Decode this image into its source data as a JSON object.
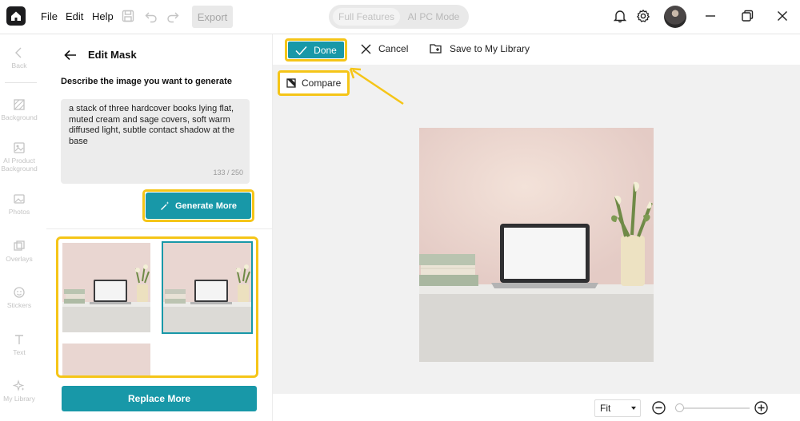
{
  "menu": {
    "file": "File",
    "edit": "Edit",
    "help": "Help",
    "export": "Export"
  },
  "mode_switch": {
    "full": "Full Features",
    "ai_pc": "AI PC Mode"
  },
  "rail": {
    "back": "Back",
    "background": "Background",
    "ai_product_background": "AI Product Background",
    "photos": "Photos",
    "overlays": "Overlays",
    "stickers": "Stickers",
    "text": "Text",
    "my_library": "My Library"
  },
  "panel": {
    "title": "Edit Mask",
    "prompt_label": "Describe the image you want to generate",
    "prompt_text": "a stack of three hardcover books lying flat, muted cream and sage covers, soft warm diffused light, subtle contact shadow at the base",
    "char_count": "133 / 250",
    "generate_more": "Generate More",
    "replace_more": "Replace More"
  },
  "actions": {
    "done": "Done",
    "cancel": "Cancel",
    "save_library": "Save to My Library",
    "compare": "Compare"
  },
  "zoom": {
    "mode": "Fit"
  },
  "colors": {
    "accent": "#1898a8",
    "highlight": "#f5c518"
  }
}
